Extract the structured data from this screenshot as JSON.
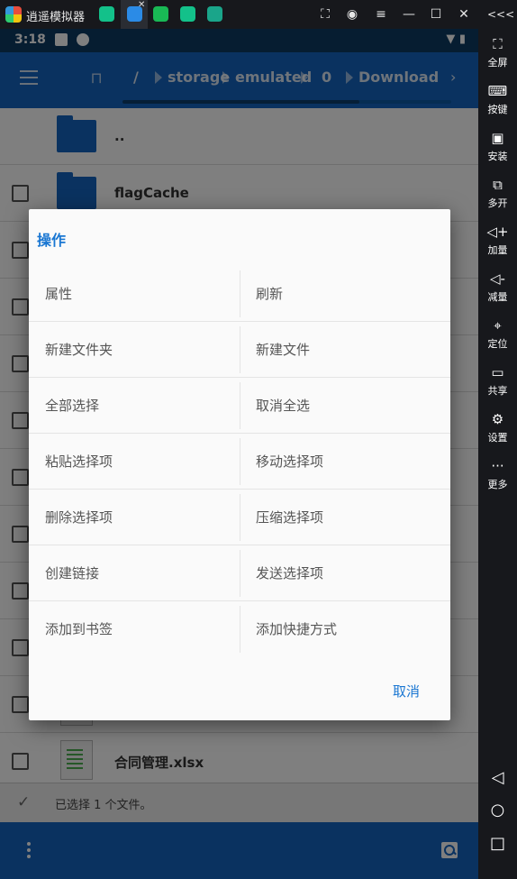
{
  "window": {
    "title": "逍遥模拟器",
    "controls": [
      "screenshot-icon",
      "account-icon",
      "menu-icon",
      "minimize-icon",
      "maximize-icon",
      "close-icon",
      "collapse-icon"
    ],
    "collapse_glyph": "<<<"
  },
  "sidebar": {
    "items": [
      {
        "label": "全屏",
        "icon": "fullscreen-icon",
        "glyph": "⛶"
      },
      {
        "label": "按键",
        "icon": "keyboard-icon",
        "glyph": "⌨"
      },
      {
        "label": "安装",
        "icon": "apk-install-icon",
        "glyph": "▣"
      },
      {
        "label": "多开",
        "icon": "multi-instance-icon",
        "glyph": "⧉"
      },
      {
        "label": "加量",
        "icon": "volume-up-icon",
        "glyph": "◁+"
      },
      {
        "label": "减量",
        "icon": "volume-down-icon",
        "glyph": "◁-"
      },
      {
        "label": "定位",
        "icon": "location-icon",
        "glyph": "⌖"
      },
      {
        "label": "共享",
        "icon": "shared-folder-icon",
        "glyph": "▭"
      },
      {
        "label": "设置",
        "icon": "settings-gear-icon",
        "glyph": "⚙"
      },
      {
        "label": "更多",
        "icon": "more-dots-icon",
        "glyph": "···"
      }
    ],
    "nav": [
      {
        "icon": "back-triangle-icon",
        "glyph": "◁"
      },
      {
        "icon": "home-circle-icon",
        "glyph": "○"
      },
      {
        "icon": "recents-square-icon",
        "glyph": "□"
      }
    ]
  },
  "statusbar": {
    "time": "3:18",
    "icons": [
      "notification-a-icon",
      "shield-icon",
      "wifi-icon",
      "battery-icon"
    ]
  },
  "appbar": {
    "breadcrumbs": [
      "/",
      "storage",
      "emulated",
      "0",
      "Download"
    ]
  },
  "files": [
    {
      "name": "..",
      "type": "folder",
      "checkbox": false
    },
    {
      "name": "flagCache",
      "type": "folder",
      "checkbox": true
    },
    {
      "name": "",
      "type": "hidden",
      "checkbox": true
    },
    {
      "name": "",
      "type": "hidden",
      "checkbox": true
    },
    {
      "name": "",
      "type": "hidden",
      "checkbox": true
    },
    {
      "name": "",
      "type": "hidden",
      "checkbox": true
    },
    {
      "name": "",
      "type": "hidden",
      "checkbox": true
    },
    {
      "name": "",
      "type": "hidden",
      "checkbox": true
    },
    {
      "name": "",
      "type": "hidden",
      "checkbox": true
    },
    {
      "name": "",
      "type": "hidden",
      "checkbox": true
    },
    {
      "name": "",
      "type": "hidden",
      "checkbox": true
    },
    {
      "name": "合同管理.xlsx",
      "type": "xlsx",
      "checkbox": true
    }
  ],
  "selection_status": "已选择 1 个文件。",
  "dialog": {
    "title": "操作",
    "rows": [
      [
        "属性",
        "刷新"
      ],
      [
        "新建文件夹",
        "新建文件"
      ],
      [
        "全部选择",
        "取消全选"
      ],
      [
        "粘贴选择项",
        "移动选择项"
      ],
      [
        "删除选择项",
        "压缩选择项"
      ],
      [
        "创建链接",
        "发送选择项"
      ],
      [
        "添加到书签",
        "添加快捷方式"
      ]
    ],
    "cancel": "取消"
  },
  "colors": {
    "primary": "#1565c0",
    "accent": "#1976d2",
    "statusbar": "#0d3b63",
    "emulator_chrome": "#17181c"
  }
}
